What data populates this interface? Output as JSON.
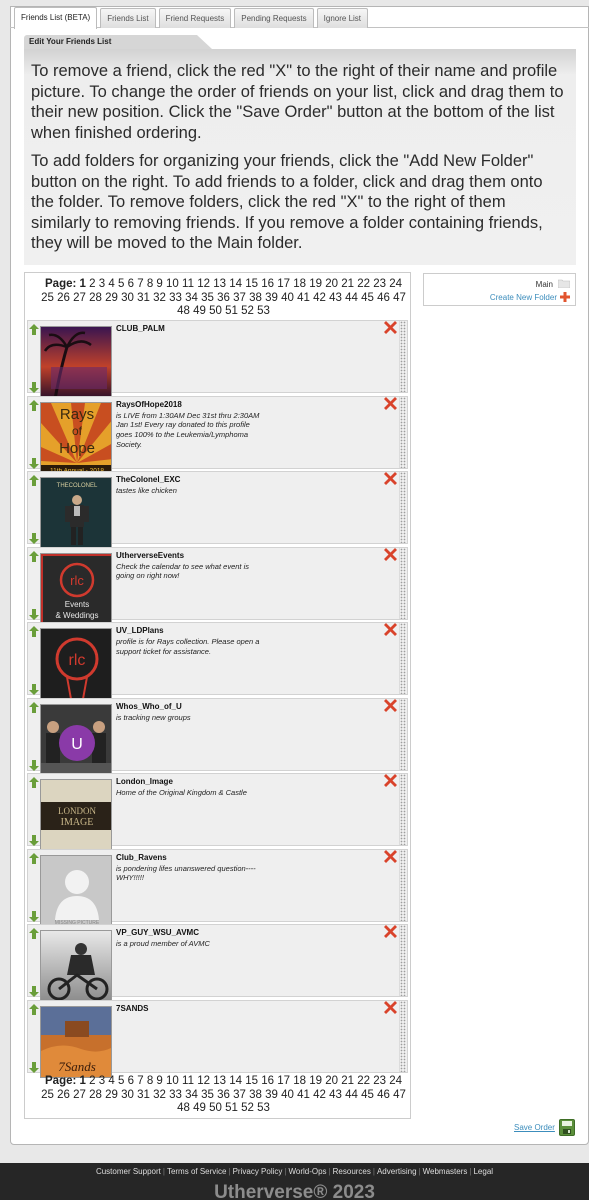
{
  "tabs": [
    {
      "label": "Friends List (BETA)",
      "active": true
    },
    {
      "label": "Friends List",
      "active": false
    },
    {
      "label": "Friend Requests",
      "active": false
    },
    {
      "label": "Pending Requests",
      "active": false
    },
    {
      "label": "Ignore List",
      "active": false
    }
  ],
  "section_title": "Edit Your Friends List",
  "instructions": [
    "To remove a friend, click the red \"X\" to the right of their name and profile picture. To change the order of friends on your list, click and drag them to their new position. Click the \"Save Order\" button at the bottom of the list when finished ordering.",
    "To add folders for organizing your friends, click the \"Add New Folder\" button on the right. To add friends to a folder, click and drag them onto the folder. To remove folders, click the red \"X\" to the right of them similarly to removing friends. If you remove a folder containing friends, they will be moved to the Main folder."
  ],
  "pagination": {
    "label": "Page:",
    "current": 1,
    "total": 53
  },
  "friends": [
    {
      "name": "CLUB_PALM",
      "status": "",
      "avatar": "club-palm-avatar"
    },
    {
      "name": "RaysOfHope2018",
      "status": "is LIVE from 1:30AM Dec 31st thru 2:30AM Jan 1st! Every ray donated to this profile goes 100% to the Leukemia/Lymphoma Society.",
      "avatar": "rays-of-hope-avatar",
      "avatar_text": [
        "Rays",
        "of",
        "Hope",
        "11th Annual - 2018"
      ]
    },
    {
      "name": "TheColonel_EXC",
      "status": "tastes like chicken",
      "avatar": "colonel-avatar",
      "avatar_text": [
        "THECOLONEL"
      ]
    },
    {
      "name": "UtherverseEvents",
      "status": "Check the calendar to see what event is going on right now!",
      "avatar": "events-avatar",
      "avatar_text": [
        "Events",
        "& Weddings"
      ]
    },
    {
      "name": "UV_LDPlans",
      "status": "profile is for Rays collection. Please open a support ticket for assistance.",
      "avatar": "ldplans-avatar"
    },
    {
      "name": "Whos_Who_of_U",
      "status": "is tracking new groups",
      "avatar": "whos-who-avatar"
    },
    {
      "name": "London_Image",
      "status": "Home of the Original Kingdom & Castle",
      "avatar": "london-image-avatar",
      "avatar_text": [
        "LONDON",
        "IMAGE"
      ]
    },
    {
      "name": "Club_Ravens",
      "status": "is pondering lifes unanswered question----WHY!!!!!",
      "avatar": "missing-picture-avatar",
      "avatar_text": [
        "MISSING PICTURE"
      ]
    },
    {
      "name": "VP_GUY_WSU_AVMC",
      "status": "is a proud member of AVMC",
      "avatar": "biker-avatar"
    },
    {
      "name": "7SANDS",
      "status": "",
      "avatar": "7sands-avatar",
      "avatar_text": [
        "7Sands"
      ]
    }
  ],
  "folders": {
    "main_label": "Main",
    "create_label": "Create New Folder"
  },
  "save_order_label": "Save Order",
  "footer": {
    "links": [
      "Customer Support",
      "Terms of Service",
      "Privacy Policy",
      "World-Ops",
      "Resources",
      "Advertising",
      "Webmasters",
      "Legal"
    ],
    "brand": "Utherverse® 2023"
  },
  "colors": {
    "link": "#3c8dbc",
    "delete": "#d9432b",
    "arrow": "#6a9e3a",
    "footer_bg": "#262626"
  }
}
